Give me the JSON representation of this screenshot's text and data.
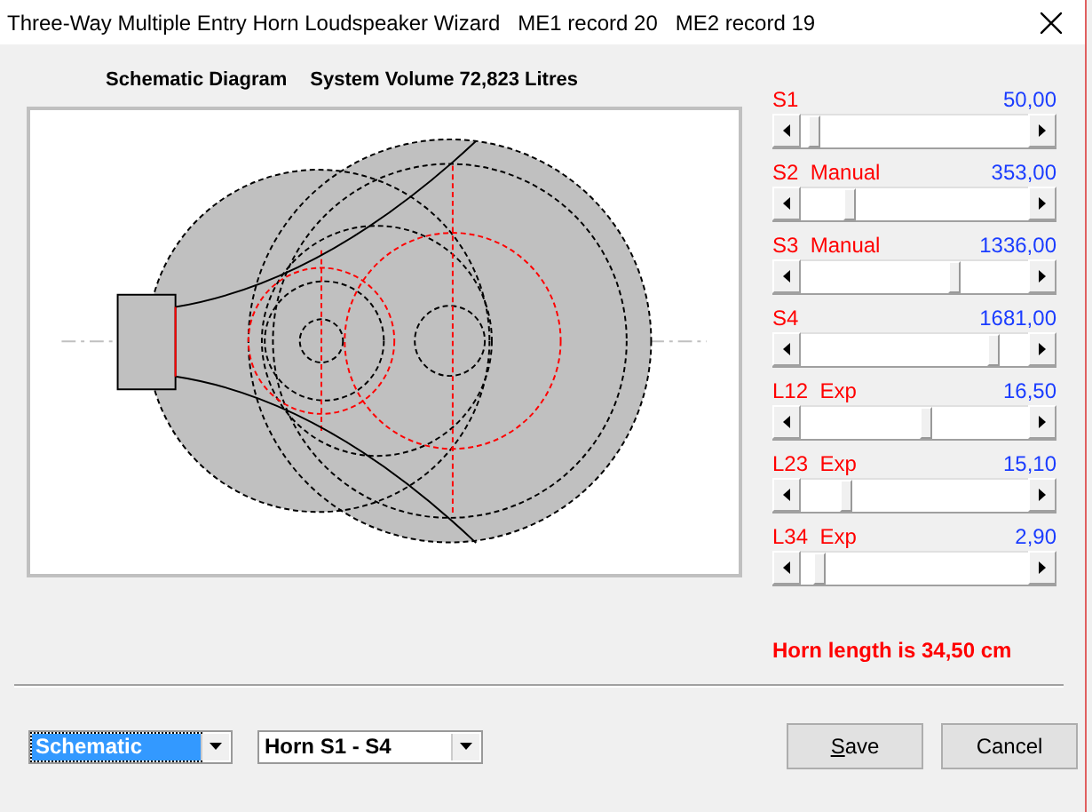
{
  "window": {
    "title": "Three-Way Multiple Entry Horn Loudspeaker Wizard   ME1 record 20   ME2 record 19"
  },
  "diagram": {
    "title": "Schematic Diagram",
    "volume": "System Volume 72,823 Litres"
  },
  "sliders": [
    {
      "label": "S1",
      "value": "50,00",
      "level": 0.03
    },
    {
      "label": "S2  Manual",
      "value": "353,00",
      "level": 0.2
    },
    {
      "label": "S3  Manual",
      "value": "1336,00",
      "level": 0.69
    },
    {
      "label": "S4",
      "value": "1681,00",
      "level": 0.87
    },
    {
      "label": "L12  Exp",
      "value": "16,50",
      "level": 0.55
    },
    {
      "label": "L23  Exp",
      "value": "15,10",
      "level": 0.18
    },
    {
      "label": "L34  Exp",
      "value": "2,90",
      "level": 0.06
    }
  ],
  "horn_length": "Horn length is 34,50 cm",
  "dropdowns": [
    {
      "value": "Schematic",
      "focused": true
    },
    {
      "value": "Horn S1 - S4",
      "focused": false
    }
  ],
  "buttons": [
    {
      "mnemonic": "S",
      "label": "ave"
    },
    {
      "label": "Cancel"
    }
  ]
}
